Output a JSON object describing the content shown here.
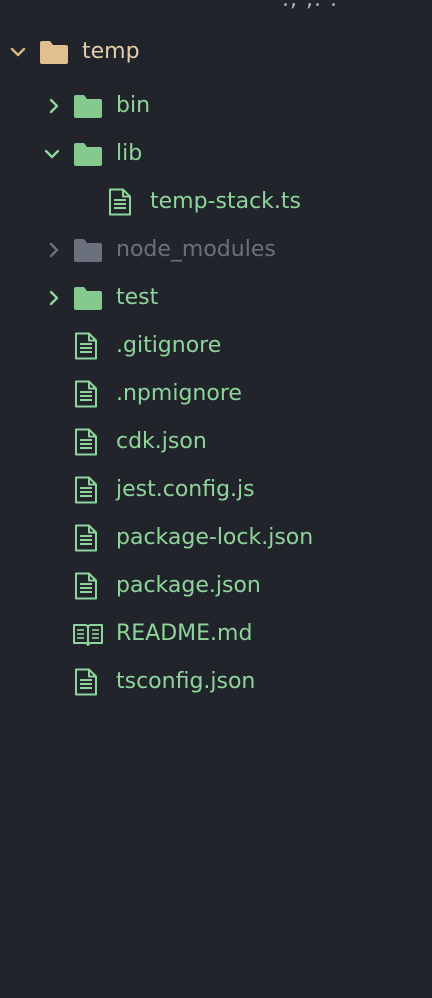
{
  "colors": {
    "background": "#21252b",
    "file_text": "#8fd49a",
    "root_text": "#e4ceaa",
    "root_folder": "#e2c08d",
    "folder_green": "#84c98e",
    "folder_muted": "#6b717c",
    "muted_text": "#6b717c",
    "chevron": "#8fd49a",
    "root_chevron": "#d9b981"
  },
  "top_partial_text": "., ,. .",
  "explorer": {
    "root": {
      "label": "temp",
      "icon": "folder-icon",
      "expanded": true
    },
    "items": [
      {
        "label": "bin",
        "type": "folder",
        "expanded": false,
        "icon": "folder-icon"
      },
      {
        "label": "lib",
        "type": "folder",
        "expanded": true,
        "icon": "folder-icon"
      },
      {
        "label": "temp-stack.ts",
        "type": "file",
        "icon": "file-icon"
      },
      {
        "label": "node_modules",
        "type": "folder",
        "expanded": false,
        "ignored": true,
        "icon": "folder-icon"
      },
      {
        "label": "test",
        "type": "folder",
        "expanded": false,
        "icon": "folder-icon"
      },
      {
        "label": ".gitignore",
        "type": "file",
        "icon": "file-icon"
      },
      {
        "label": ".npmignore",
        "type": "file",
        "icon": "file-icon"
      },
      {
        "label": "cdk.json",
        "type": "file",
        "icon": "file-icon"
      },
      {
        "label": "jest.config.js",
        "type": "file",
        "icon": "file-icon"
      },
      {
        "label": "package-lock.json",
        "type": "file",
        "icon": "file-icon"
      },
      {
        "label": "package.json",
        "type": "file",
        "icon": "file-icon"
      },
      {
        "label": "README.md",
        "type": "file",
        "icon": "book-icon"
      },
      {
        "label": "tsconfig.json",
        "type": "file",
        "icon": "file-icon"
      }
    ]
  }
}
